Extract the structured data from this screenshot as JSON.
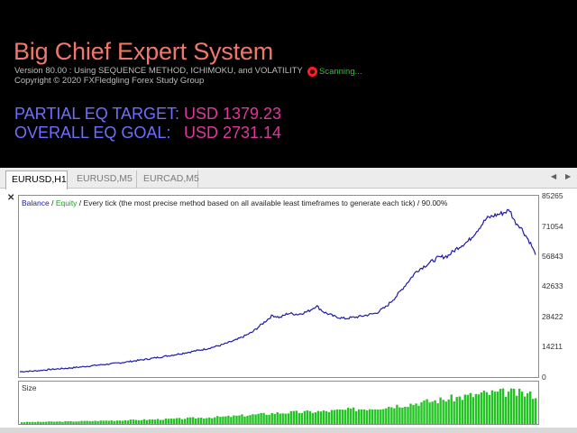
{
  "panel": {
    "title": "Big Chief Expert System",
    "version_line": "Version 80.00 : Using SEQUENCE METHOD, ICHIMOKU, and VOLATILITY",
    "copyright_line": "Copyright © 2020 FXFledgling Forex Study Group",
    "status_text": "Scanning...",
    "status_color": "#ff1d1d",
    "rows": [
      {
        "label": "PARTIAL EQ TARGET:",
        "value": "USD 1379.23"
      },
      {
        "label": "OVERALL EQ GOAL:",
        "value": "USD 2731.14"
      }
    ],
    "label_color": "#6f6fff",
    "value_color": "#e0379e"
  },
  "tabs": [
    {
      "label": "EURUSD,H1",
      "active": true
    },
    {
      "label": "EURUSD,M5",
      "active": false
    },
    {
      "label": "EURCAD,M5",
      "active": false
    }
  ],
  "scroll": {
    "left_icon": "triangle-left-icon",
    "right_icon": "triangle-right-icon"
  },
  "chart": {
    "close_icon": "x-close-icon",
    "legend": {
      "balance": "Balance",
      "sep": " / ",
      "equity": "Equity",
      "rest": " / Every tick (the most precise method based on all available least timeframes to generate each tick) / 90.00%"
    },
    "size_label": "Size"
  },
  "chart_data": {
    "type": "line",
    "title": "",
    "xlabel": "",
    "ylabel": "",
    "ylim": [
      0,
      85265
    ],
    "yticks": [
      "85265",
      "71054",
      "56843",
      "42633",
      "28422",
      "14211",
      "0"
    ],
    "ytick_values": [
      85265,
      71054,
      56843,
      42633,
      28422,
      14211,
      0
    ],
    "series": [
      {
        "name": "Balance",
        "color": "#1c1ca8",
        "x": [
          0,
          0.03,
          0.06,
          0.09,
          0.12,
          0.15,
          0.18,
          0.21,
          0.24,
          0.27,
          0.3,
          0.33,
          0.36,
          0.39,
          0.42,
          0.45,
          0.47,
          0.49,
          0.505,
          0.52,
          0.54,
          0.56,
          0.575,
          0.59,
          0.61,
          0.63,
          0.66,
          0.69,
          0.71,
          0.73,
          0.75,
          0.77,
          0.79,
          0.81,
          0.83,
          0.85,
          0.87,
          0.89,
          0.905,
          0.92,
          0.935,
          0.95,
          0.96,
          0.97,
          0.98,
          0.99,
          1.0
        ],
        "values": [
          2500,
          2900,
          3600,
          4100,
          4800,
          5600,
          6300,
          7200,
          8200,
          9300,
          10500,
          11800,
          13200,
          15000,
          17500,
          21000,
          25000,
          29000,
          28000,
          30000,
          29500,
          31000,
          33500,
          30500,
          28500,
          27500,
          28500,
          30000,
          33000,
          38000,
          44000,
          50000,
          53000,
          56000,
          57000,
          61000,
          64000,
          70000,
          74500,
          76000,
          77000,
          78500,
          73000,
          71000,
          67000,
          63000,
          57500
        ]
      },
      {
        "name": "Equity",
        "color": "#19a019",
        "x": [],
        "values": []
      }
    ],
    "size": {
      "x": [
        0,
        0.1,
        0.2,
        0.3,
        0.4,
        0.5,
        0.6,
        0.7,
        0.8,
        0.9,
        0.95,
        1.0
      ],
      "values": [
        0.05,
        0.07,
        0.1,
        0.14,
        0.2,
        0.3,
        0.35,
        0.45,
        0.62,
        0.82,
        0.86,
        0.78
      ],
      "color": "#22c422"
    }
  }
}
